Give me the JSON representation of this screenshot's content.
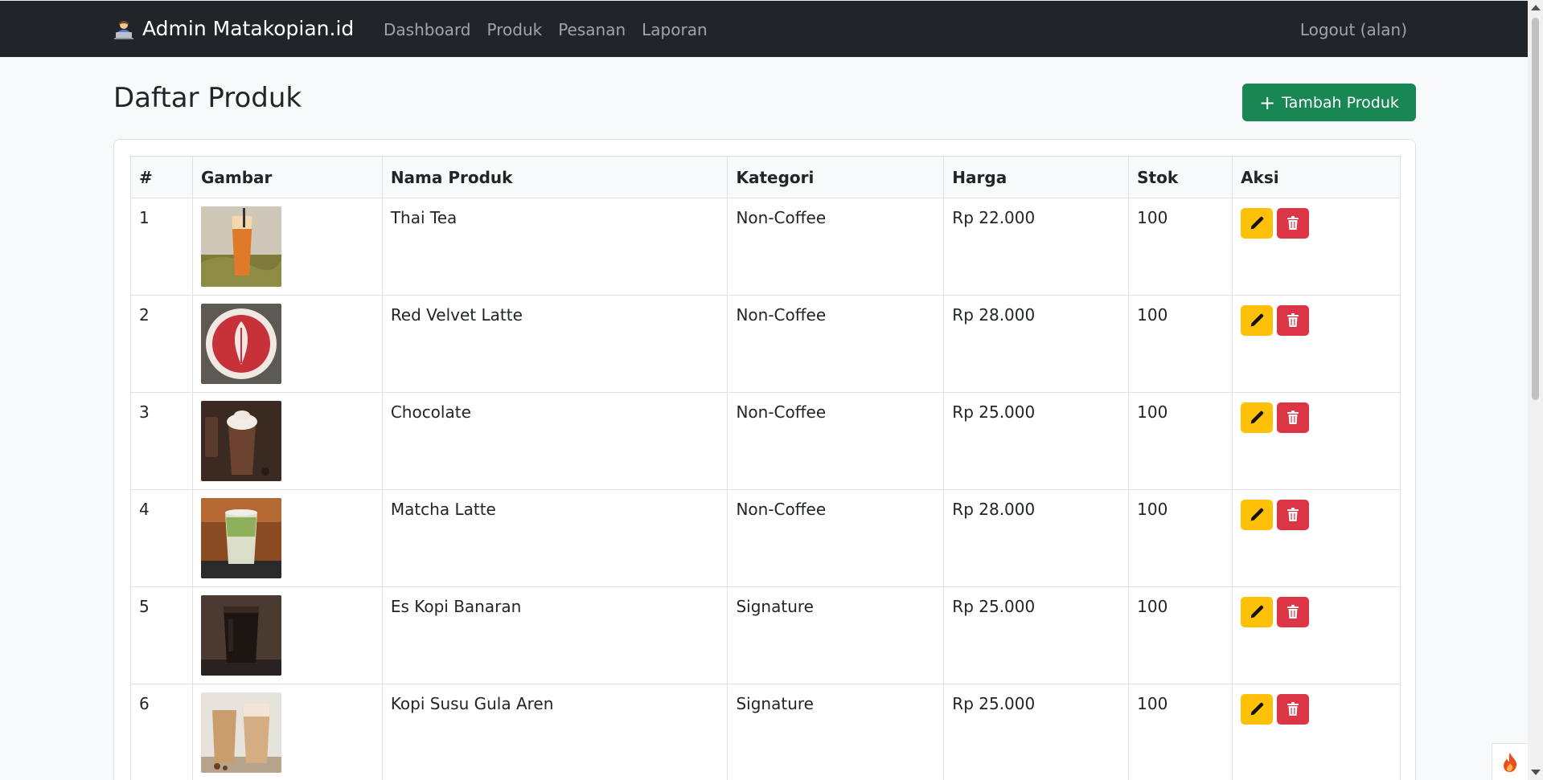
{
  "navbar": {
    "brand": "Admin Matakopian.id",
    "brand_icon": "person-at-laptop-icon",
    "links": [
      "Dashboard",
      "Produk",
      "Pesanan",
      "Laporan"
    ],
    "logout": "Logout (alan)"
  },
  "page": {
    "title": "Daftar Produk",
    "add_button": "Tambah Produk"
  },
  "table": {
    "headers": [
      "#",
      "Gambar",
      "Nama Produk",
      "Kategori",
      "Harga",
      "Stok",
      "Aksi"
    ],
    "rows": [
      {
        "no": "1",
        "name": "Thai Tea",
        "category": "Non-Coffee",
        "price": "Rp 22.000",
        "stock": "100",
        "image": "thai-tea-photo"
      },
      {
        "no": "2",
        "name": "Red Velvet Latte",
        "category": "Non-Coffee",
        "price": "Rp 28.000",
        "stock": "100",
        "image": "red-velvet-latte-photo"
      },
      {
        "no": "3",
        "name": "Chocolate",
        "category": "Non-Coffee",
        "price": "Rp 25.000",
        "stock": "100",
        "image": "chocolate-photo"
      },
      {
        "no": "4",
        "name": "Matcha Latte",
        "category": "Non-Coffee",
        "price": "Rp 28.000",
        "stock": "100",
        "image": "matcha-latte-photo"
      },
      {
        "no": "5",
        "name": "Es Kopi Banaran",
        "category": "Signature",
        "price": "Rp 25.000",
        "stock": "100",
        "image": "es-kopi-banaran-photo"
      },
      {
        "no": "6",
        "name": "Kopi Susu Gula Aren",
        "category": "Signature",
        "price": "Rp 25.000",
        "stock": "100",
        "image": "kopi-susu-gula-aren-photo"
      }
    ]
  },
  "colors": {
    "navbar_bg": "#212529",
    "success": "#198754",
    "warning": "#ffc107",
    "danger": "#dc3545"
  }
}
